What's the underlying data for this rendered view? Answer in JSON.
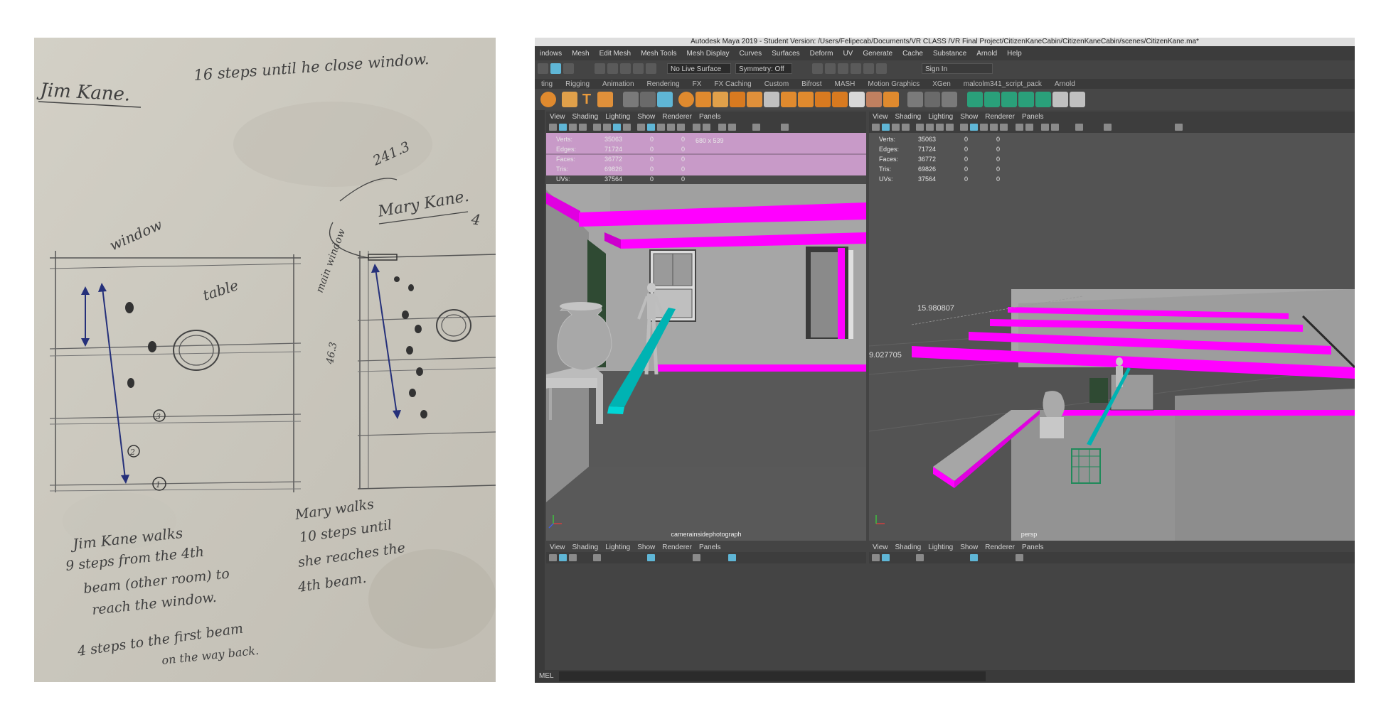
{
  "sketch": {
    "title": "Jim Kane.",
    "top_note": "16 steps until he close window.",
    "label_window": "window",
    "label_table": "table",
    "label_mary": "Mary Kane.",
    "label_measure": "241.3",
    "label_main_window": "main window",
    "label_depth": "46.3",
    "step_marks": [
      "3",
      "2",
      "1"
    ],
    "note_jim": [
      "Jim Kane walks",
      "9 steps from the 4th",
      "beam (other room) to",
      "reach the window.",
      "4 steps to the first beam",
      "on the way back."
    ],
    "note_mary": [
      "Mary walks",
      "10 steps until",
      "she reaches the",
      "4th beam."
    ]
  },
  "maya": {
    "title": "Autodesk Maya 2019 - Student Version: /Users/Felipecab/Documents/VR CLASS /VR Final Project/CitizenKaneCabin/CitizenKaneCabin/scenes/CitizenKane.ma*",
    "menus": [
      "indows",
      "Mesh",
      "Edit Mesh",
      "Mesh Tools",
      "Mesh Display",
      "Curves",
      "Surfaces",
      "Deform",
      "UV",
      "Generate",
      "Cache",
      "Substance",
      "Arnold",
      "Help"
    ],
    "live_surface": "No Live Surface",
    "symmetry": "Symmetry: Off",
    "sign_in": "Sign In",
    "shelf_tabs": [
      "ting",
      "Rigging",
      "Animation",
      "Rendering",
      "FX",
      "FX Caching",
      "Custom",
      "Bifrost",
      "MASH",
      "Motion Graphics",
      "XGen",
      "malcolm341_script_pack",
      "Arnold"
    ],
    "panel_menu": [
      "View",
      "Shading",
      "Lighting",
      "Show",
      "Renderer",
      "Panels"
    ],
    "hud_stats": [
      {
        "label": "Verts:",
        "v1": "35063",
        "v2": "0",
        "v3": "0"
      },
      {
        "label": "Edges:",
        "v1": "71724",
        "v2": "0",
        "v3": "0"
      },
      {
        "label": "Faces:",
        "v1": "36772",
        "v2": "0",
        "v3": "0"
      },
      {
        "label": "Tris:",
        "v1": "69826",
        "v2": "0",
        "v3": "0"
      },
      {
        "label": "UVs:",
        "v1": "37564",
        "v2": "0",
        "v3": "0"
      }
    ],
    "resolution": "680 x 539",
    "left_camera": "camerainsidephotograph",
    "right_camera": "persp",
    "dim_a": "15.980807",
    "dim_b": "9.027705",
    "mel": "MEL",
    "colors": {
      "beam": "#ff00ff",
      "path": "#00b3b3",
      "wall": "#a6a6a6",
      "floor": "#585858"
    }
  }
}
